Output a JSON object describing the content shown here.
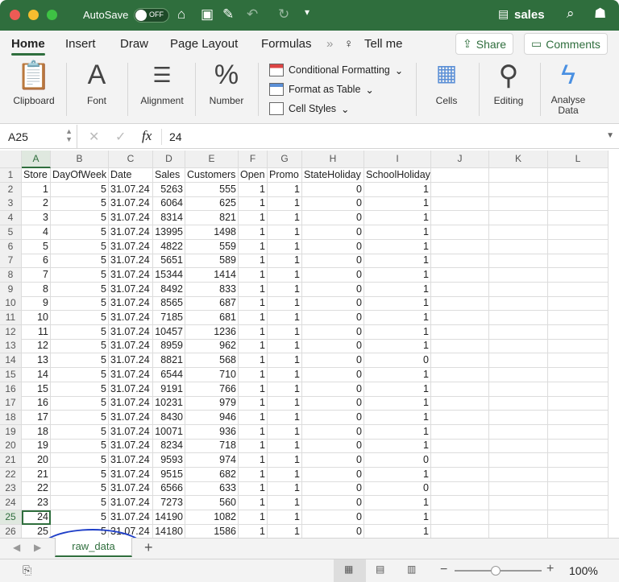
{
  "titlebar": {
    "autosave": "AutoSave",
    "toggle": "OFF",
    "filename": "sales"
  },
  "tabs": [
    "Home",
    "Insert",
    "Draw",
    "Page Layout",
    "Formulas"
  ],
  "tell_me": "Tell me",
  "share": "Share",
  "comments": "Comments",
  "ribbon": {
    "clipboard": "Clipboard",
    "font": "Font",
    "alignment": "Alignment",
    "number": "Number",
    "cond_format": "Conditional Formatting",
    "format_table": "Format as Table",
    "cell_styles": "Cell Styles",
    "cells": "Cells",
    "editing": "Editing",
    "analyse": "Analyse",
    "analyse2": "Data"
  },
  "formula": {
    "name_box": "A25",
    "fx": "fx",
    "value": "24"
  },
  "columns": [
    "A",
    "B",
    "C",
    "D",
    "E",
    "F",
    "G",
    "H",
    "I",
    "J",
    "K",
    "L"
  ],
  "headers": [
    "Store",
    "DayOfWeek",
    "Date",
    "Sales",
    "Customers",
    "Open",
    "Promo",
    "StateHoliday",
    "SchoolHoliday"
  ],
  "rows": [
    [
      "1",
      "5",
      "31.07.24",
      "5263",
      "555",
      "1",
      "1",
      "0",
      "1"
    ],
    [
      "2",
      "5",
      "31.07.24",
      "6064",
      "625",
      "1",
      "1",
      "0",
      "1"
    ],
    [
      "3",
      "5",
      "31.07.24",
      "8314",
      "821",
      "1",
      "1",
      "0",
      "1"
    ],
    [
      "4",
      "5",
      "31.07.24",
      "13995",
      "1498",
      "1",
      "1",
      "0",
      "1"
    ],
    [
      "5",
      "5",
      "31.07.24",
      "4822",
      "559",
      "1",
      "1",
      "0",
      "1"
    ],
    [
      "6",
      "5",
      "31.07.24",
      "5651",
      "589",
      "1",
      "1",
      "0",
      "1"
    ],
    [
      "7",
      "5",
      "31.07.24",
      "15344",
      "1414",
      "1",
      "1",
      "0",
      "1"
    ],
    [
      "8",
      "5",
      "31.07.24",
      "8492",
      "833",
      "1",
      "1",
      "0",
      "1"
    ],
    [
      "9",
      "5",
      "31.07.24",
      "8565",
      "687",
      "1",
      "1",
      "0",
      "1"
    ],
    [
      "10",
      "5",
      "31.07.24",
      "7185",
      "681",
      "1",
      "1",
      "0",
      "1"
    ],
    [
      "11",
      "5",
      "31.07.24",
      "10457",
      "1236",
      "1",
      "1",
      "0",
      "1"
    ],
    [
      "12",
      "5",
      "31.07.24",
      "8959",
      "962",
      "1",
      "1",
      "0",
      "1"
    ],
    [
      "13",
      "5",
      "31.07.24",
      "8821",
      "568",
      "1",
      "1",
      "0",
      "0"
    ],
    [
      "14",
      "5",
      "31.07.24",
      "6544",
      "710",
      "1",
      "1",
      "0",
      "1"
    ],
    [
      "15",
      "5",
      "31.07.24",
      "9191",
      "766",
      "1",
      "1",
      "0",
      "1"
    ],
    [
      "16",
      "5",
      "31.07.24",
      "10231",
      "979",
      "1",
      "1",
      "0",
      "1"
    ],
    [
      "17",
      "5",
      "31.07.24",
      "8430",
      "946",
      "1",
      "1",
      "0",
      "1"
    ],
    [
      "18",
      "5",
      "31.07.24",
      "10071",
      "936",
      "1",
      "1",
      "0",
      "1"
    ],
    [
      "19",
      "5",
      "31.07.24",
      "8234",
      "718",
      "1",
      "1",
      "0",
      "1"
    ],
    [
      "20",
      "5",
      "31.07.24",
      "9593",
      "974",
      "1",
      "1",
      "0",
      "0"
    ],
    [
      "21",
      "5",
      "31.07.24",
      "9515",
      "682",
      "1",
      "1",
      "0",
      "1"
    ],
    [
      "22",
      "5",
      "31.07.24",
      "6566",
      "633",
      "1",
      "1",
      "0",
      "0"
    ],
    [
      "23",
      "5",
      "31.07.24",
      "7273",
      "560",
      "1",
      "1",
      "0",
      "1"
    ],
    [
      "24",
      "5",
      "31.07.24",
      "14190",
      "1082",
      "1",
      "1",
      "0",
      "1"
    ],
    [
      "25",
      "5",
      "31.07.24",
      "14180",
      "1586",
      "1",
      "1",
      "0",
      "1"
    ]
  ],
  "selected_row": 25,
  "sheet_tab": "raw_data",
  "zoom": "100%",
  "accent": "#2f6e3d"
}
